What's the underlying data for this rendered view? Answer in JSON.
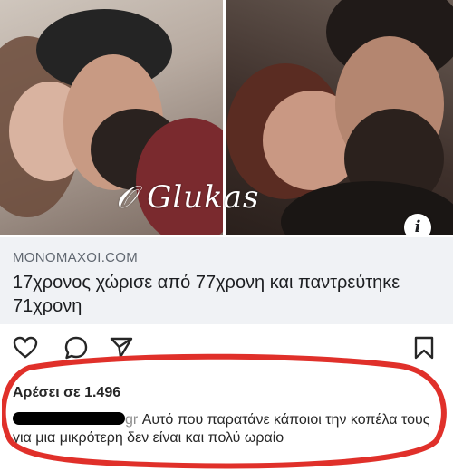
{
  "post": {
    "watermark": "Glukas",
    "link": {
      "domain": "MONOMAXOI.COM",
      "title": "17χρονος χώρισε από 77χρονη και παντρεύτηκε 71χρονη"
    },
    "actions": [
      "heart-icon",
      "comment-icon",
      "share-icon",
      "bookmark-icon"
    ],
    "likes_text": "Αρέσει σε 1.496",
    "comment": {
      "author_suffix": "gr",
      "text": "Αυτό που παρατάνε κάποιοι την κοπέλα τους για μια μικρότερη δεν είναι και πολύ ωραίο"
    }
  },
  "colors": {
    "annotation": "#e0302a",
    "card_bg": "#f0f2f5"
  }
}
